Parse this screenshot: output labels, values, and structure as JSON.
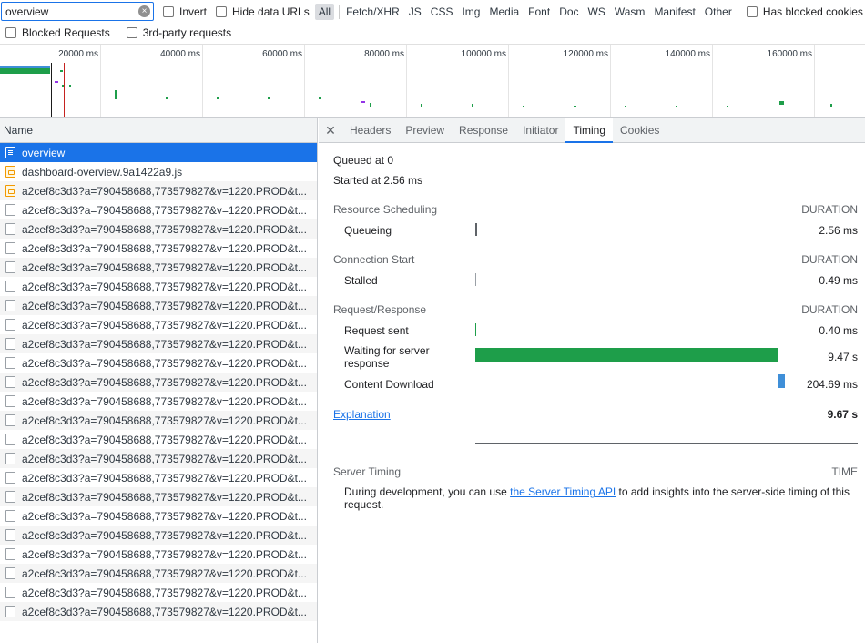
{
  "toolbar": {
    "filter_value": "overview",
    "invert_label": "Invert",
    "hide_data_urls_label": "Hide data URLs",
    "types": [
      "All",
      "Fetch/XHR",
      "JS",
      "CSS",
      "Img",
      "Media",
      "Font",
      "Doc",
      "WS",
      "Wasm",
      "Manifest",
      "Other"
    ],
    "active_type": "All",
    "has_blocked_cookies_label": "Has blocked cookies",
    "blocked_requests_label": "Blocked Requests",
    "third_party_label": "3rd-party requests"
  },
  "overview": {
    "ticks": [
      "20000 ms",
      "40000 ms",
      "60000 ms",
      "80000 ms",
      "100000 ms",
      "120000 ms",
      "140000 ms",
      "160000 ms"
    ]
  },
  "request_list": {
    "header": "Name",
    "rows": [
      {
        "name": "overview",
        "icon": "document-icon",
        "selected": true
      },
      {
        "name": "dashboard-overview.9a1422a9.js",
        "icon": "script-icon"
      },
      {
        "name": "a2cef8c3d3?a=790458688,773579827&v=1220.PROD&t...",
        "icon": "script-icon"
      },
      {
        "name": "a2cef8c3d3?a=790458688,773579827&v=1220.PROD&t...",
        "icon": "file-icon"
      },
      {
        "name": "a2cef8c3d3?a=790458688,773579827&v=1220.PROD&t...",
        "icon": "file-icon"
      },
      {
        "name": "a2cef8c3d3?a=790458688,773579827&v=1220.PROD&t...",
        "icon": "file-icon"
      },
      {
        "name": "a2cef8c3d3?a=790458688,773579827&v=1220.PROD&t...",
        "icon": "file-icon"
      },
      {
        "name": "a2cef8c3d3?a=790458688,773579827&v=1220.PROD&t...",
        "icon": "file-icon"
      },
      {
        "name": "a2cef8c3d3?a=790458688,773579827&v=1220.PROD&t...",
        "icon": "file-icon"
      },
      {
        "name": "a2cef8c3d3?a=790458688,773579827&v=1220.PROD&t...",
        "icon": "file-icon"
      },
      {
        "name": "a2cef8c3d3?a=790458688,773579827&v=1220.PROD&t...",
        "icon": "file-icon"
      },
      {
        "name": "a2cef8c3d3?a=790458688,773579827&v=1220.PROD&t...",
        "icon": "file-icon"
      },
      {
        "name": "a2cef8c3d3?a=790458688,773579827&v=1220.PROD&t...",
        "icon": "file-icon"
      },
      {
        "name": "a2cef8c3d3?a=790458688,773579827&v=1220.PROD&t...",
        "icon": "file-icon"
      },
      {
        "name": "a2cef8c3d3?a=790458688,773579827&v=1220.PROD&t...",
        "icon": "file-icon"
      },
      {
        "name": "a2cef8c3d3?a=790458688,773579827&v=1220.PROD&t...",
        "icon": "file-icon"
      },
      {
        "name": "a2cef8c3d3?a=790458688,773579827&v=1220.PROD&t...",
        "icon": "file-icon"
      },
      {
        "name": "a2cef8c3d3?a=790458688,773579827&v=1220.PROD&t...",
        "icon": "file-icon"
      },
      {
        "name": "a2cef8c3d3?a=790458688,773579827&v=1220.PROD&t...",
        "icon": "file-icon"
      },
      {
        "name": "a2cef8c3d3?a=790458688,773579827&v=1220.PROD&t...",
        "icon": "file-icon"
      },
      {
        "name": "a2cef8c3d3?a=790458688,773579827&v=1220.PROD&t...",
        "icon": "file-icon"
      },
      {
        "name": "a2cef8c3d3?a=790458688,773579827&v=1220.PROD&t...",
        "icon": "file-icon"
      },
      {
        "name": "a2cef8c3d3?a=790458688,773579827&v=1220.PROD&t...",
        "icon": "file-icon"
      },
      {
        "name": "a2cef8c3d3?a=790458688,773579827&v=1220.PROD&t...",
        "icon": "file-icon"
      },
      {
        "name": "a2cef8c3d3?a=790458688,773579827&v=1220.PROD&t...",
        "icon": "file-icon"
      }
    ]
  },
  "detail": {
    "tabs": [
      "Headers",
      "Preview",
      "Response",
      "Initiator",
      "Timing",
      "Cookies"
    ],
    "active_tab": "Timing",
    "timing": {
      "queued_at": "Queued at 0",
      "started_at": "Started at 2.56 ms",
      "duration_header": "DURATION",
      "sections": [
        {
          "title": "Resource Scheduling",
          "phases": [
            {
              "label": "Queueing",
              "value": "2.56 ms"
            }
          ]
        },
        {
          "title": "Connection Start",
          "phases": [
            {
              "label": "Stalled",
              "value": "0.49 ms"
            }
          ]
        },
        {
          "title": "Request/Response",
          "phases": [
            {
              "label": "Request sent",
              "value": "0.40 ms"
            },
            {
              "label": "Waiting for server response",
              "value": "9.47 s"
            },
            {
              "label": "Content Download",
              "value": "204.69 ms"
            }
          ]
        }
      ],
      "explanation_link": "Explanation",
      "total": "9.67 s",
      "server_timing_title": "Server Timing",
      "time_header": "TIME",
      "server_timing_text_before": "During development, you can use ",
      "server_timing_link": "the Server Timing API",
      "server_timing_text_after": " to add insights into the server-side timing of this request."
    }
  },
  "colors": {
    "accent": "#1a73e8",
    "waiting_bar": "#1e9e4a",
    "download_bar": "#3f8fd8"
  }
}
